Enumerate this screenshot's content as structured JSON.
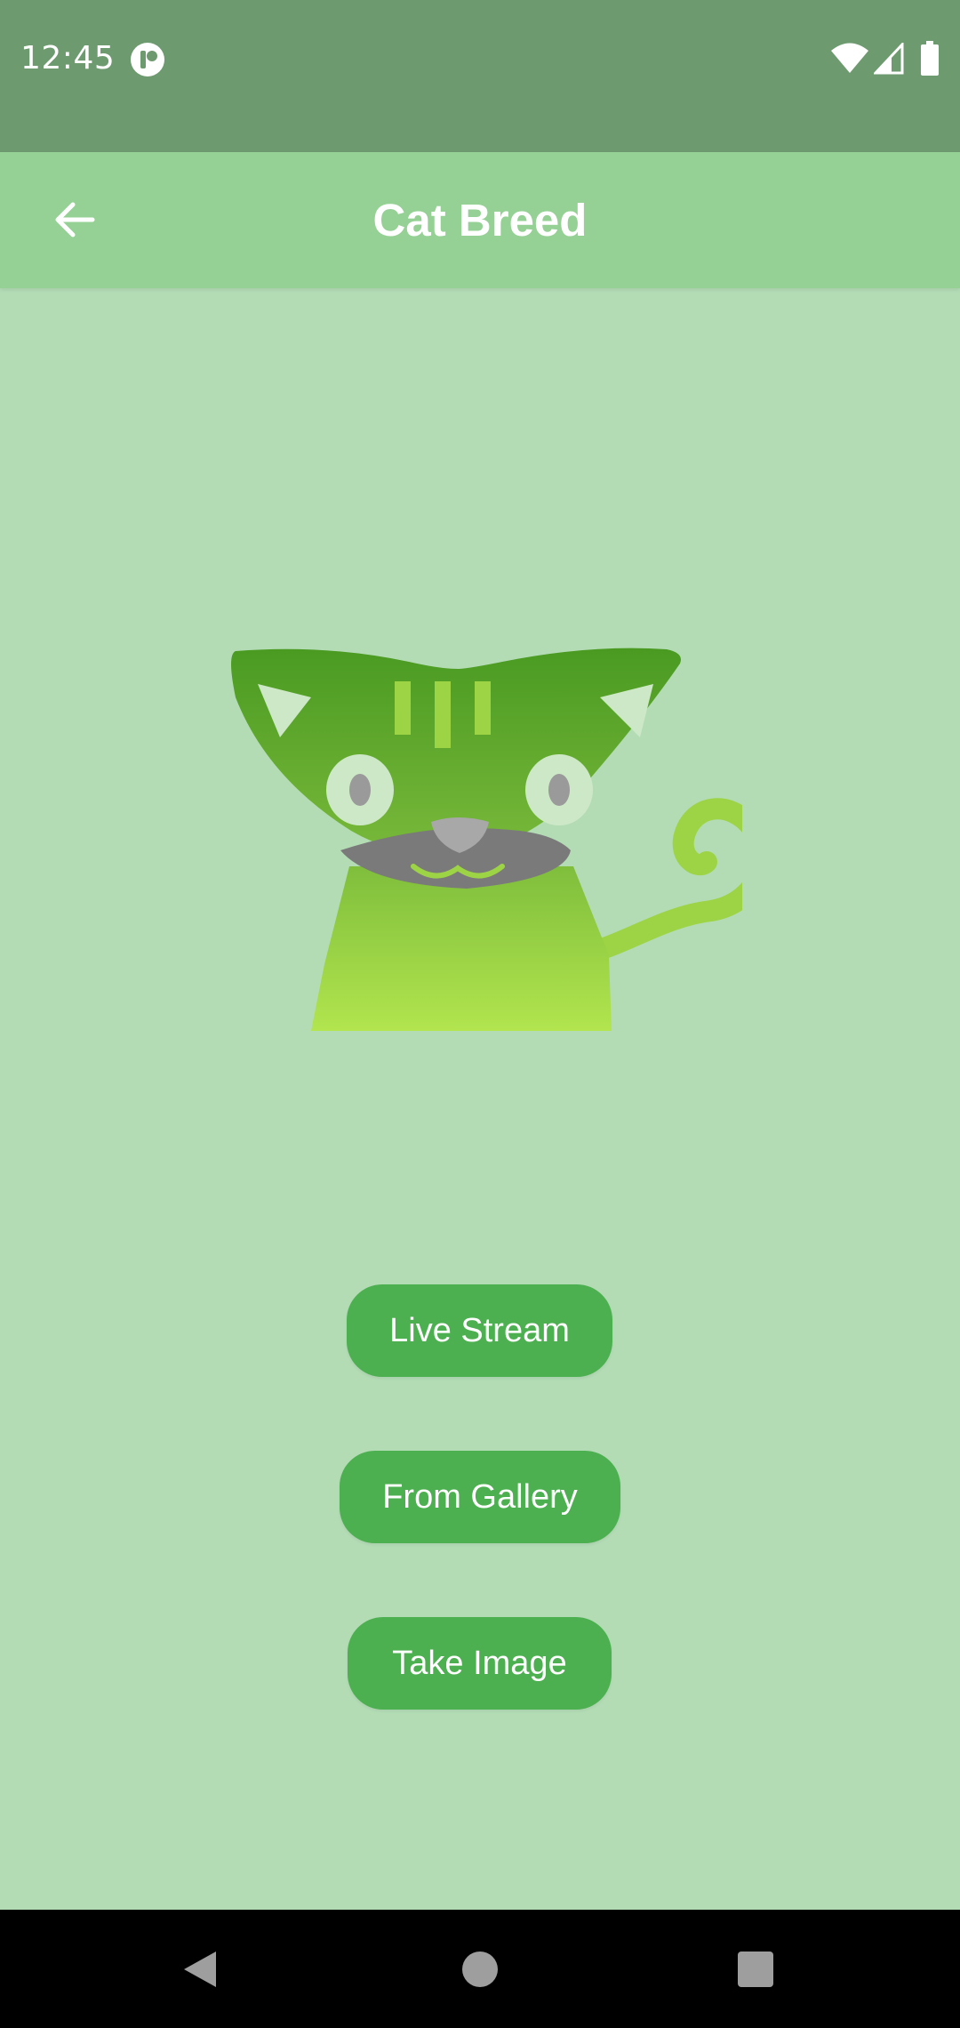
{
  "status_bar": {
    "time": "12:45",
    "icons": [
      "app-notification-icon",
      "wifi-icon",
      "cell-signal-icon",
      "battery-icon"
    ]
  },
  "app_bar": {
    "title": "Cat Breed",
    "back_icon": "arrow-back-icon"
  },
  "hero": {
    "image": "green-cat-logo"
  },
  "actions": {
    "live_stream": "Live Stream",
    "from_gallery": "From Gallery",
    "take_image": "Take Image"
  },
  "nav_bar": {
    "icons": [
      "nav-back-icon",
      "nav-home-icon",
      "nav-recents-icon"
    ]
  },
  "colors": {
    "status_bar": "#6e9a70",
    "app_bar": "#95d095",
    "background": "#b3dcb5",
    "button": "#4caf50",
    "button_text": "#ffffff"
  }
}
